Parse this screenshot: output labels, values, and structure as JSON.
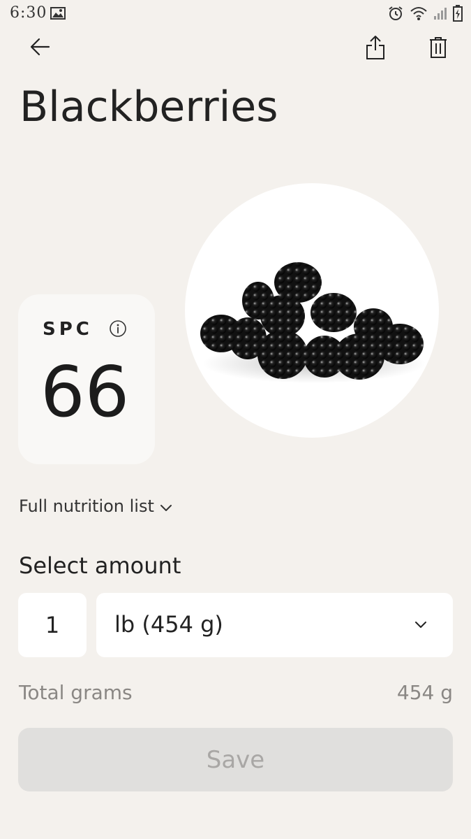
{
  "status_bar": {
    "time": "6:30",
    "icons": [
      "image-icon",
      "alarm-icon",
      "wifi-icon",
      "signal-icon",
      "battery-icon"
    ]
  },
  "nav": {
    "back_icon": "arrow-left-icon",
    "share_icon": "share-icon",
    "delete_icon": "trash-icon"
  },
  "food": {
    "title": "Blackberries",
    "image": "blackberries-photo"
  },
  "spc": {
    "label": "SPC",
    "value": "66",
    "info_icon": "info-icon"
  },
  "nutrition": {
    "toggle_label": "Full nutrition list"
  },
  "amount": {
    "section_label": "Select amount",
    "quantity": "1",
    "unit": "lb (454 g)"
  },
  "totals": {
    "label": "Total grams",
    "value": "454 g"
  },
  "actions": {
    "save_label": "Save"
  },
  "colors": {
    "background": "#f4f1ed",
    "card": "#f9f8f6",
    "save_disabled_bg": "#e0dfdd",
    "save_disabled_text": "#a9a7a5",
    "muted_text": "#8a8784"
  }
}
